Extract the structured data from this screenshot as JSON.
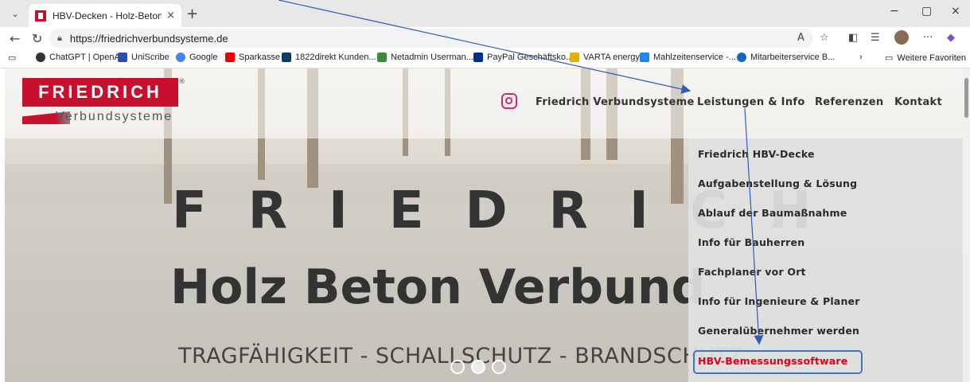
{
  "browser": {
    "tab_title": "HBV-Decken - Holz-Beton-Verbur",
    "close_glyph": "×",
    "new_tab_glyph": "+",
    "url": "https://friedrichverbundsysteme.de",
    "window_controls": [
      "−",
      "▢",
      "×"
    ],
    "bookmarks": [
      {
        "label": "ChatGPT | OpenAI",
        "icon": "openai-icon",
        "color": "#333333"
      },
      {
        "label": "UniScribe",
        "icon": "uniscribe-icon",
        "color": "#2f4fa8"
      },
      {
        "label": "Google",
        "icon": "google-icon",
        "color": "#4285f4"
      },
      {
        "label": "Sparkasse",
        "icon": "sparkasse-icon",
        "color": "#e60000"
      },
      {
        "label": "1822direkt Kunden...",
        "icon": "bank-icon",
        "color": "#0a3d62"
      },
      {
        "label": "Netadmin Userman...",
        "icon": "netadmin-icon",
        "color": "#3c8c3c"
      },
      {
        "label": "PayPal Geschäftsko...",
        "icon": "paypal-icon",
        "color": "#003087"
      },
      {
        "label": "VARTA energy",
        "icon": "varta-icon",
        "color": "#e2b100"
      },
      {
        "label": "Mahlzeitenservice -...",
        "icon": "grid-icon",
        "color": "#1e88e5"
      },
      {
        "label": "Mitarbeiterservice B...",
        "icon": "globe-icon",
        "color": "#1565c0"
      }
    ],
    "more_favorites": "Weitere Favoriten"
  },
  "site": {
    "logo_text": "FRIEDRICH",
    "logo_sub": "Verbundsysteme",
    "nav": [
      "Friedrich Verbundsysteme",
      "Leistungen & Info",
      "Referenzen",
      "Kontakt"
    ],
    "dropdown": [
      "Friedrich HBV-Decke",
      "Aufgabenstellung & Lösung",
      "Ablauf der Baumaßnahme",
      "Info für Bauherren",
      "Fachplaner vor Ort",
      "Info für Ingenieure & Planer",
      "Generalübernehmer werden",
      "HBV-Bemessungssoftware"
    ],
    "dropdown_active_index": 7,
    "hero_title": "FRIEDRICH",
    "hero_subtitle": "Holz Beton Verbund",
    "hero_tagline": "TRAGFÄHIGKEIT - SCHALLSCHUTZ - BRANDSCHUTZ",
    "slider": {
      "count": 3,
      "active": 1
    }
  },
  "colors": {
    "brand_red": "#c8102e",
    "active_link": "#e1001a",
    "annotation_blue": "#2f5cb8"
  }
}
